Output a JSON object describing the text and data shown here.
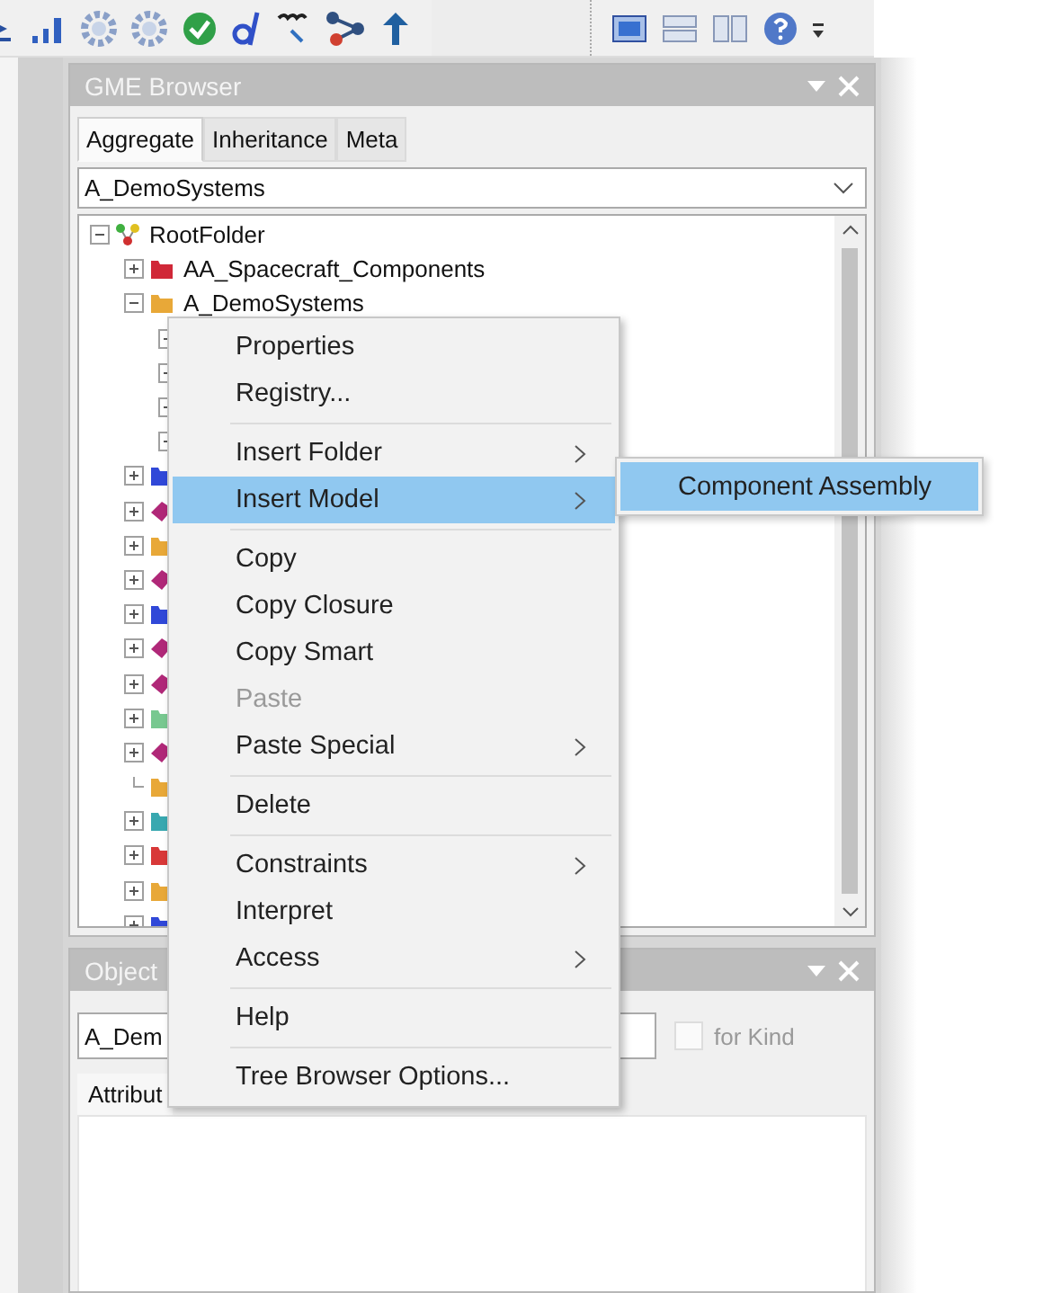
{
  "browser": {
    "title": "GME Browser",
    "tabs": [
      {
        "label": "Aggregate",
        "selected": true
      },
      {
        "label": "Inheritance",
        "selected": false
      },
      {
        "label": "Meta",
        "selected": false
      }
    ],
    "combo": {
      "value": "A_DemoSystems"
    },
    "tree": [
      {
        "label": "RootFolder",
        "kind": "root",
        "color": "#d03030",
        "expandable": true,
        "expanded": true,
        "children": [
          {
            "label": "AA_Spacecraft_Components",
            "kind": "folder",
            "color": "#d02838",
            "expandable": true,
            "expanded": false
          },
          {
            "label": "A_DemoSystems",
            "kind": "folder",
            "color": "#e8a838",
            "expandable": true,
            "expanded": true,
            "children": [
              {
                "expandable": true,
                "expanded": false
              },
              {
                "expandable": true,
                "expanded": false
              },
              {
                "expandable": true,
                "expanded": false
              },
              {
                "expandable": true,
                "expanded": false
              }
            ]
          },
          {
            "kind": "folder",
            "color": "#3048d8",
            "expandable": true,
            "expanded": false
          },
          {
            "kind": "model",
            "color": "#b02878",
            "expandable": true,
            "expanded": false
          },
          {
            "kind": "folder",
            "color": "#e8a838",
            "expandable": true,
            "expanded": false
          },
          {
            "kind": "model",
            "color": "#b02878",
            "expandable": true,
            "expanded": false
          },
          {
            "kind": "folder",
            "color": "#3048d8",
            "expandable": true,
            "expanded": false
          },
          {
            "kind": "model",
            "color": "#b02878",
            "expandable": true,
            "expanded": false
          },
          {
            "kind": "model",
            "color": "#b02878",
            "expandable": true,
            "expanded": false
          },
          {
            "kind": "folder",
            "color": "#78c890",
            "expandable": true,
            "expanded": false
          },
          {
            "kind": "model",
            "color": "#b02878",
            "expandable": true,
            "expanded": false
          },
          {
            "kind": "folder",
            "color": "#e8a838",
            "expandable": false
          },
          {
            "kind": "folder",
            "color": "#38a8b0",
            "expandable": true,
            "expanded": false
          },
          {
            "kind": "folder",
            "color": "#d83838",
            "expandable": true,
            "expanded": false
          },
          {
            "kind": "folder",
            "color": "#e8a838",
            "expandable": true,
            "expanded": false
          },
          {
            "kind": "folder",
            "color": "#3048d8",
            "expandable": true,
            "expanded": false
          }
        ]
      }
    ]
  },
  "inspector": {
    "title": "Object",
    "name_value": "A_Dem",
    "for_kind": {
      "label": "for Kind",
      "checked": false
    },
    "tabs": [
      {
        "label": "Attribut",
        "selected": true
      }
    ]
  },
  "context_menu": [
    {
      "kind": "item",
      "label": "Properties",
      "submenu": false,
      "disabled": false,
      "selected": false
    },
    {
      "kind": "item",
      "label": "Registry...",
      "submenu": false,
      "disabled": false,
      "selected": false
    },
    {
      "kind": "separator"
    },
    {
      "kind": "item",
      "label": "Insert Folder",
      "submenu": true,
      "disabled": false,
      "selected": false
    },
    {
      "kind": "item",
      "label": "Insert Model",
      "submenu": true,
      "disabled": false,
      "selected": true
    },
    {
      "kind": "separator"
    },
    {
      "kind": "item",
      "label": "Copy",
      "submenu": false,
      "disabled": false,
      "selected": false
    },
    {
      "kind": "item",
      "label": "Copy Closure",
      "submenu": false,
      "disabled": false,
      "selected": false
    },
    {
      "kind": "item",
      "label": "Copy Smart",
      "submenu": false,
      "disabled": false,
      "selected": false
    },
    {
      "kind": "item",
      "label": "Paste",
      "submenu": false,
      "disabled": true,
      "selected": false
    },
    {
      "kind": "item",
      "label": "Paste Special",
      "submenu": true,
      "disabled": false,
      "selected": false
    },
    {
      "kind": "separator"
    },
    {
      "kind": "item",
      "label": "Delete",
      "submenu": false,
      "disabled": false,
      "selected": false
    },
    {
      "kind": "separator"
    },
    {
      "kind": "item",
      "label": "Constraints",
      "submenu": true,
      "disabled": false,
      "selected": false
    },
    {
      "kind": "item",
      "label": "Interpret",
      "submenu": false,
      "disabled": false,
      "selected": false
    },
    {
      "kind": "item",
      "label": "Access",
      "submenu": true,
      "disabled": false,
      "selected": false
    },
    {
      "kind": "separator"
    },
    {
      "kind": "item",
      "label": "Help",
      "submenu": false,
      "disabled": false,
      "selected": false
    },
    {
      "kind": "separator"
    },
    {
      "kind": "item",
      "label": "Tree Browser Options...",
      "submenu": false,
      "disabled": false,
      "selected": false
    }
  ],
  "submenu": [
    {
      "label": "Component Assembly",
      "selected": true
    }
  ]
}
